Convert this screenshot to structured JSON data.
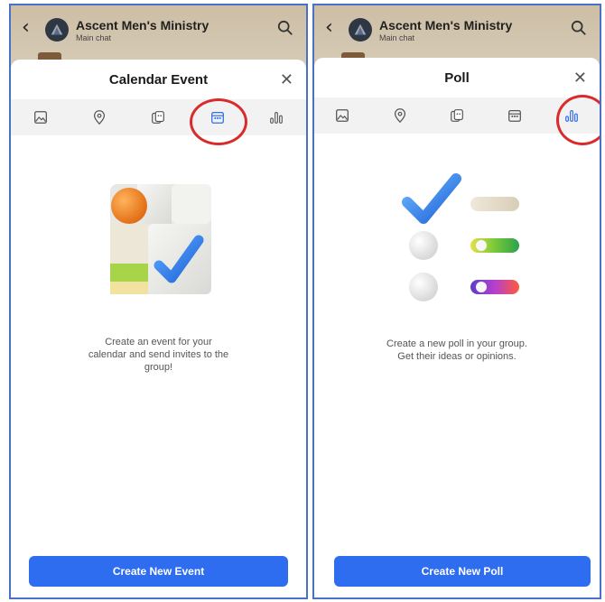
{
  "panels": [
    {
      "header": {
        "title": "Ascent Men's Ministry",
        "subtitle": "Main chat"
      },
      "sheet": {
        "title": "Calendar Event",
        "description": "Create an event for your\ncalendar and send invites to the\ngroup!",
        "button_label": "Create New Event",
        "selected_tab": "calendar"
      }
    },
    {
      "header": {
        "title": "Ascent Men's Ministry",
        "subtitle": "Main chat"
      },
      "sheet": {
        "title": "Poll",
        "description": "Create a new poll in your group.\nGet their ideas or opinions.",
        "button_label": "Create New Poll",
        "selected_tab": "poll"
      }
    }
  ],
  "tabs": [
    {
      "icon": "image-icon"
    },
    {
      "icon": "location-pin-icon"
    },
    {
      "icon": "sticker-icon"
    },
    {
      "icon": "calendar-icon"
    },
    {
      "icon": "poll-icon"
    }
  ],
  "colors": {
    "accent": "#2f6df0",
    "highlight_circle": "#d92b2b",
    "panel_border": "#4a72c4"
  }
}
